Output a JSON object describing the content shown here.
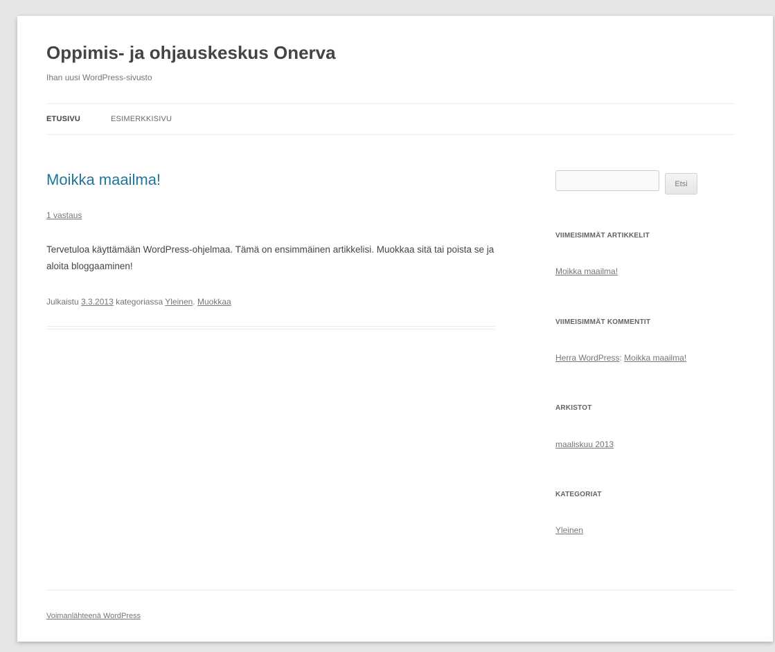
{
  "site": {
    "title": "Oppimis- ja ohjauskeskus Onerva",
    "description": "Ihan uusi WordPress-sivusto"
  },
  "nav": {
    "items": [
      {
        "label": "ETUSIVU"
      },
      {
        "label": "ESIMERKKISIVU"
      }
    ]
  },
  "post": {
    "title": "Moikka maailma!",
    "comments": "1 vastaus",
    "content": "Tervetuloa käyttämään WordPress-ohjelmaa. Tämä on ensimmäinen artikkelisi. Muokkaa sitä tai poista se ja aloita bloggaaminen!",
    "meta": {
      "prefix": "Julkaistu",
      "date": "3.3.2013",
      "in_category": "kategoriassa",
      "category": "Yleinen",
      "separator": ".",
      "edit": "Muokkaa"
    }
  },
  "sidebar": {
    "search": {
      "value": "",
      "button": "Etsi"
    },
    "recent_posts": {
      "title": "VIIMEISIMMÄT ARTIKKELIT",
      "items": [
        "Moikka maailma!"
      ]
    },
    "recent_comments": {
      "title": "VIIMEISIMMÄT KOMMENTIT",
      "author": "Herra WordPress",
      "separator": ":",
      "post": "Moikka maailma!"
    },
    "archives": {
      "title": "ARKISTOT",
      "items": [
        "maaliskuu 2013"
      ]
    },
    "categories": {
      "title": "KATEGORIAT",
      "items": [
        "Yleinen"
      ]
    }
  },
  "footer": {
    "credit": "Voimanlähteenä WordPress"
  },
  "colors": {
    "link_accent": "#21759b",
    "background": "#e6e6e6",
    "page": "#ffffff"
  }
}
